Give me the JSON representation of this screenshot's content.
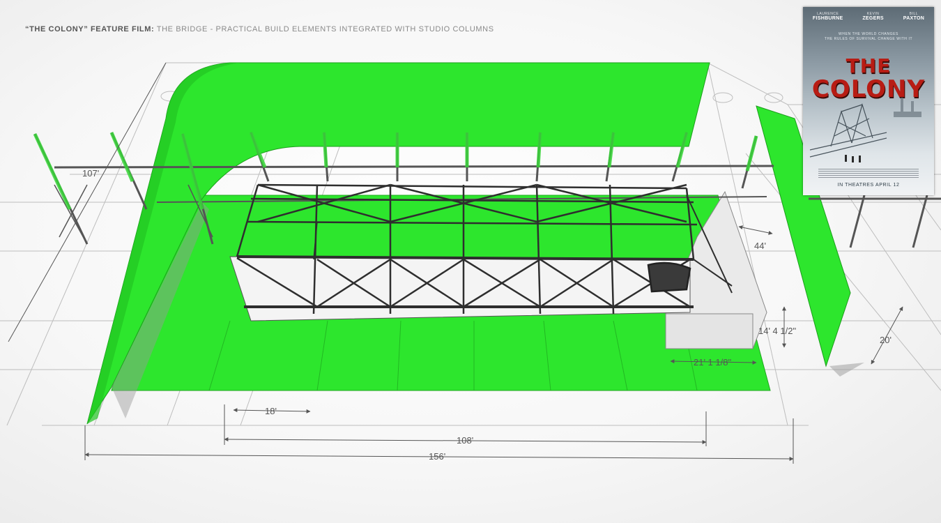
{
  "caption": {
    "bold": "“THE COLONY” FEATURE FILM:",
    "rest": "THE BRIDGE - PRACTICAL BUILD ELEMENTS INTEGRATED WITH STUDIO COLUMNS"
  },
  "dimensions": {
    "d107": "107'",
    "d44": "44'",
    "d14": "14' 4 1/2\"",
    "d21": "21' 1 1/8\"",
    "d20": "20'",
    "d18": "18'",
    "d108": "108'",
    "d156": "156'"
  },
  "poster": {
    "actor1_first": "LAURENCE",
    "actor1_last": "FISHBURNE",
    "actor2_first": "KEVIN",
    "actor2_last": "ZEGERS",
    "actor3_first": "BILL",
    "actor3_last": "PAXTON",
    "tagline1": "WHEN THE WORLD CHANGES",
    "tagline2": "THE RULES OF SURVIVAL CHANGE WITH IT",
    "title1": "THE",
    "title2": "COLONY",
    "release": "IN THEATRES APRIL 12"
  },
  "colors": {
    "greenscreen": "#2de62d",
    "steel": "#3a3a3a",
    "poster_title": "#b81c14"
  }
}
